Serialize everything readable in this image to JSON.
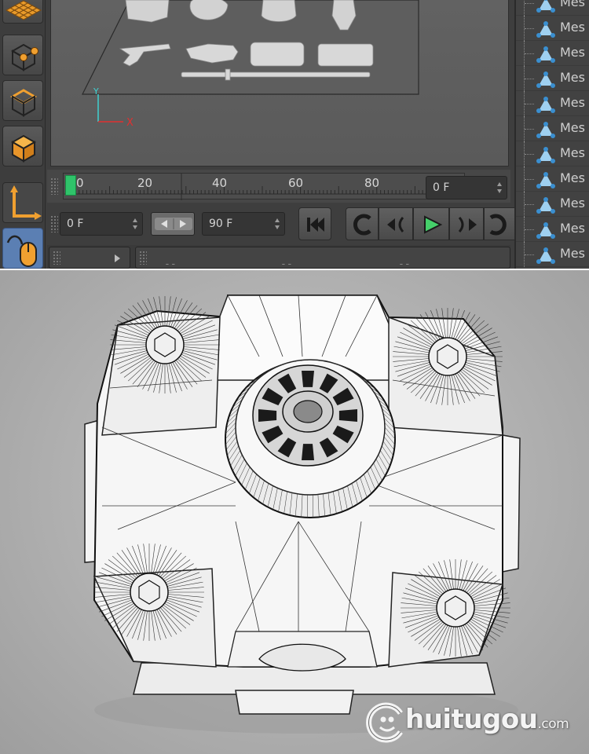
{
  "timeline": {
    "ruler_ticks": [
      "0",
      "20",
      "40",
      "60",
      "80"
    ],
    "current_frame": "0 F",
    "start_frame": "0 F",
    "end_frame": "90 F",
    "info_dashes": [
      "--",
      "--",
      "--"
    ]
  },
  "object_manager": {
    "items": [
      "Mes",
      "Mes",
      "Mes",
      "Mes",
      "Mes",
      "Mes",
      "Mes",
      "Mes",
      "Mes",
      "Mes",
      "Mes"
    ]
  },
  "viewport": {
    "axis_x": "X",
    "axis_y": "Y"
  },
  "toolbar": {
    "icons": [
      "grid-tool-icon",
      "point-mode-icon",
      "edge-mode-icon",
      "polygon-mode-icon",
      "axis-mode-icon",
      "tweak-mode-icon"
    ]
  },
  "playback": {
    "icons": [
      "go-start-icon",
      "record-icon",
      "prev-key-icon",
      "play-icon",
      "next-key-icon",
      "loop-icon"
    ]
  },
  "watermark": {
    "brand": "huitugou",
    "suffix": ".com"
  },
  "colors": {
    "accent_orange": "#f0a030",
    "playhead_green": "#2fc36a",
    "play_green": "#45d06a",
    "axis_red": "#e03030",
    "axis_cyan": "#40d0d0"
  }
}
